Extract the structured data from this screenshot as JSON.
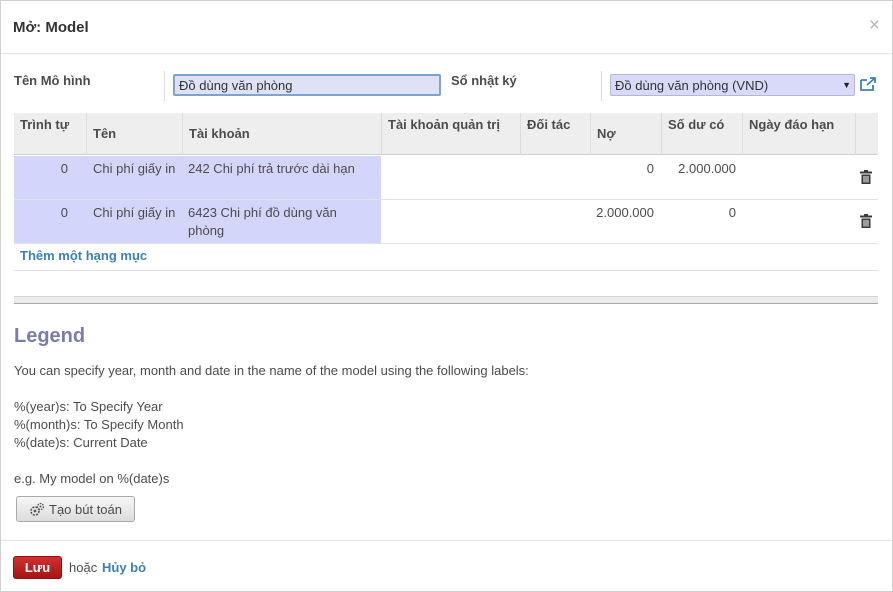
{
  "dialog": {
    "title": "Mở: Model",
    "close_glyph": "×"
  },
  "form": {
    "name_label": "Tên Mô hình",
    "name_value": "Đồ dùng văn phòng",
    "journal_label": "Sổ nhật ký",
    "journal_value": "Đồ dùng văn phòng (VND)"
  },
  "grid": {
    "headers": [
      "Trình tự",
      "Tên",
      "Tài khoản",
      "Tài khoản quản trị",
      "Đối tác",
      "Nợ",
      "Số dư có",
      "Ngày đáo hạn"
    ],
    "rows": [
      {
        "sequence": "0",
        "name": "Chi phí giấy in",
        "account": "242 Chi phí trả trước dài hạn",
        "analytic": "",
        "partner": "",
        "debit": "0",
        "credit": "2.000.000",
        "maturity": ""
      },
      {
        "sequence": "0",
        "name": "Chi phí giấy in",
        "account": "6423 Chi phí đồ dùng văn phòng",
        "analytic": "",
        "partner": "",
        "debit": "2.000.000",
        "credit": "0",
        "maturity": ""
      }
    ],
    "add_line": "Thêm một hạng mục"
  },
  "legend": {
    "title": "Legend",
    "intro": "You can specify year, month and date in the name of the model using the following labels:",
    "year": "%(year)s: To Specify Year",
    "month": "%(month)s: To Specify Month",
    "date": "%(date)s: Current Date",
    "example": "e.g. My model on %(date)s",
    "create_button": "Tạo bút toán"
  },
  "footer": {
    "save": "Lưu",
    "or": "hoặc",
    "cancel": "Hủy bỏ"
  },
  "colors": {
    "link": "#3b80b8",
    "legend_title": "#7c7bad",
    "save_button": "#c02020",
    "row_highlight": "#d4d5fb"
  }
}
